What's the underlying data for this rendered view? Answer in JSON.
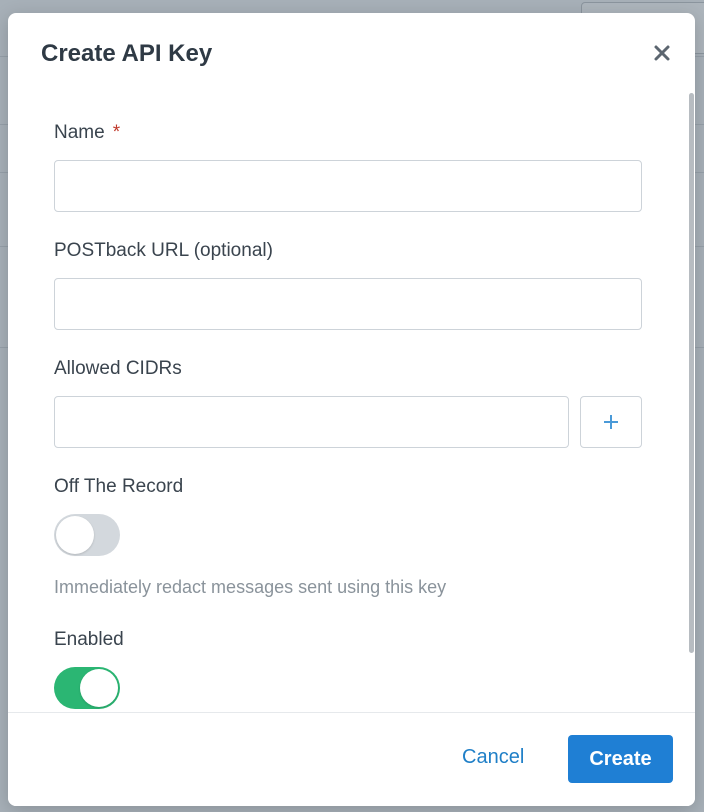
{
  "modal": {
    "title": "Create API Key",
    "close_icon": "close-icon"
  },
  "fields": {
    "name": {
      "label": "Name",
      "required_marker": "*",
      "value": ""
    },
    "postback": {
      "label": "POSTback URL (optional)",
      "value": ""
    },
    "cidrs": {
      "label": "Allowed CIDRs",
      "value": "",
      "add_icon": "plus-icon"
    },
    "off_the_record": {
      "label": "Off The Record",
      "enabled": false,
      "help": "Immediately redact messages sent using this key"
    },
    "enabled": {
      "label": "Enabled",
      "enabled": true
    }
  },
  "footer": {
    "cancel_label": "Cancel",
    "create_label": "Create"
  },
  "colors": {
    "accent": "#1f7fd4",
    "toggle_on": "#2bb673",
    "toggle_off": "#d3d8dd",
    "required": "#c0392b"
  }
}
